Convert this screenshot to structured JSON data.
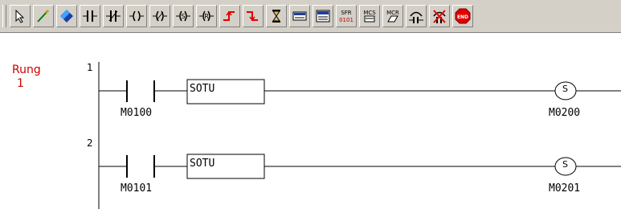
{
  "toolbar": {
    "tools": [
      {
        "name": "pointer-tool-icon"
      },
      {
        "name": "line-tool-icon"
      },
      {
        "name": "erase-tool-icon"
      },
      {
        "name": "no-contact-icon"
      },
      {
        "name": "nc-contact-icon"
      },
      {
        "name": "output-coil-icon"
      },
      {
        "name": "not-output-coil-icon"
      },
      {
        "name": "set-coil-icon"
      },
      {
        "name": "reset-coil-icon"
      },
      {
        "name": "rising-edge-icon"
      },
      {
        "name": "falling-edge-icon"
      },
      {
        "name": "timer-hourglass-icon"
      },
      {
        "name": "function-block-icon"
      },
      {
        "name": "function-block-2-icon"
      },
      {
        "name": "sfr-icon",
        "text": "SFR",
        "subtext": "0101"
      },
      {
        "name": "mcs-icon",
        "text": "MCS"
      },
      {
        "name": "mcr-icon",
        "text": "MCR"
      },
      {
        "name": "contact-insert-icon"
      },
      {
        "name": "delete-contact-icon"
      },
      {
        "name": "end-icon",
        "text": "END"
      }
    ]
  },
  "rung": {
    "label": "Rung",
    "number": "1"
  },
  "lines": [
    {
      "line_no": "1",
      "contact": "M0100",
      "block": "SOTU",
      "coil": "S",
      "coil_address": "M0200"
    },
    {
      "line_no": "2",
      "contact": "M0101",
      "block": "SOTU",
      "coil": "S",
      "coil_address": "M0201"
    }
  ]
}
